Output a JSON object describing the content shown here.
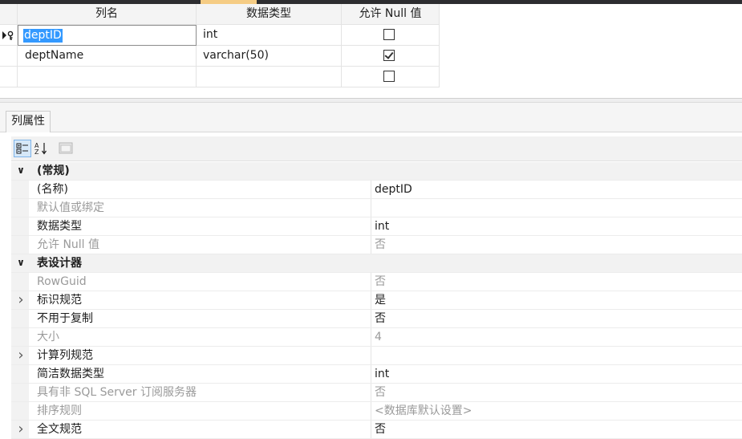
{
  "grid": {
    "headers": [
      "列名",
      "数据类型",
      "允许 Null 值"
    ],
    "rows": [
      {
        "name": "deptID",
        "type": "int",
        "allow_null": false,
        "primary_key": true,
        "editing": true
      },
      {
        "name": "deptName",
        "type": "varchar(50)",
        "allow_null": true
      },
      {
        "name": "",
        "type": "",
        "allow_null": false
      }
    ]
  },
  "panel": {
    "tab_label": "列属性",
    "toolbar": {
      "categorized_icon": "categorized-icon",
      "alphabetical_icon": "sort-alpha-icon",
      "property_pages_icon": "property-pages-icon"
    }
  },
  "properties": [
    {
      "kind": "category",
      "label": "(常规)",
      "expanded": true
    },
    {
      "kind": "prop",
      "label": "(名称)",
      "value": "deptID"
    },
    {
      "kind": "prop",
      "label": "默认值或绑定",
      "value": "",
      "gray": true
    },
    {
      "kind": "prop",
      "label": "数据类型",
      "value": "int"
    },
    {
      "kind": "prop",
      "label": "允许 Null 值",
      "value": "否",
      "gray": true
    },
    {
      "kind": "category",
      "label": "表设计器",
      "expanded": true
    },
    {
      "kind": "prop",
      "label": "RowGuid",
      "value": "否",
      "gray": true
    },
    {
      "kind": "prop",
      "label": "标识规范",
      "value": "是",
      "expandable": true
    },
    {
      "kind": "prop",
      "label": "不用于复制",
      "value": "否"
    },
    {
      "kind": "prop",
      "label": "大小",
      "value": "4",
      "gray": true
    },
    {
      "kind": "prop",
      "label": "计算列规范",
      "value": "",
      "expandable": true
    },
    {
      "kind": "prop",
      "label": "简洁数据类型",
      "value": "int"
    },
    {
      "kind": "prop",
      "label": "具有非 SQL Server 订阅服务器",
      "value": "否",
      "gray": true
    },
    {
      "kind": "prop",
      "label": "排序规则",
      "value": "<数据库默认设置>",
      "gray": true
    },
    {
      "kind": "prop",
      "label": "全文规范",
      "value": "否",
      "expandable": true
    }
  ],
  "colors": {
    "selection": "#3399ff",
    "category_bg": "#f2f2f2",
    "gray_text": "#9a9a9a",
    "title_bar": "#2d2d30",
    "title_accent": "#f5cc84"
  }
}
